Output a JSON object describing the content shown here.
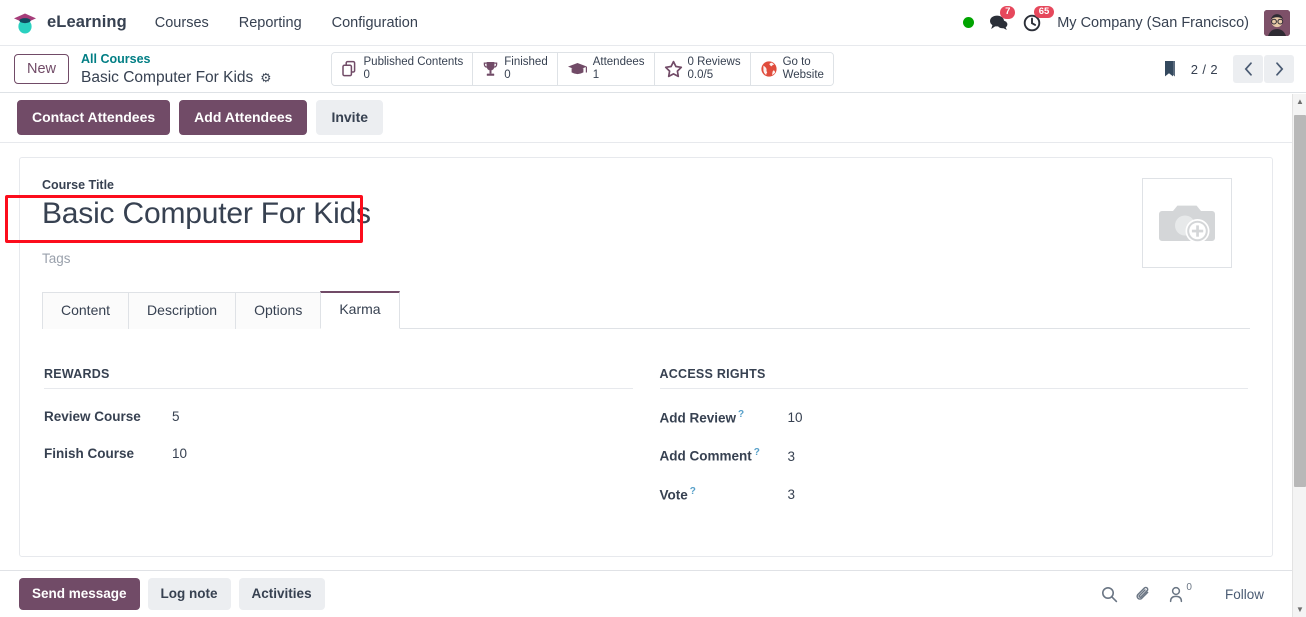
{
  "navbar": {
    "app_name": "eLearning",
    "logo_icon": "graduation-cap-icon",
    "menu": [
      {
        "label": "Courses"
      },
      {
        "label": "Reporting"
      },
      {
        "label": "Configuration"
      }
    ],
    "presence_icon": "presence-dot-online",
    "messages_icon": "messages-icon",
    "messages_count": "7",
    "activities_icon": "activities-clock-icon",
    "activities_count": "65",
    "company": "My Company (San Francisco)",
    "avatar_icon": "user-avatar"
  },
  "control_panel": {
    "new_label": "New",
    "breadcrumb_parent": "All Courses",
    "breadcrumb_current": "Basic Computer For Kids",
    "gear_icon": "gear-icon",
    "stats": [
      {
        "icon": "copy-documents-icon",
        "label": "Published Contents",
        "value": "0"
      },
      {
        "icon": "trophy-icon",
        "label": "Finished",
        "value": "0"
      },
      {
        "icon": "graduation-cap-icon",
        "label": "Attendees",
        "value": "1"
      },
      {
        "icon": "star-icon",
        "label": "0 Reviews",
        "value": "0.0/5"
      },
      {
        "icon": "globe-icon",
        "label": "Go to",
        "value": "Website"
      }
    ],
    "bookmark_icon": "bookmark-icon",
    "pager": "2 / 2",
    "prev_icon": "chevron-left-icon",
    "next_icon": "chevron-right-icon"
  },
  "action_bar": {
    "buttons": [
      {
        "label": "Contact Attendees",
        "style": "primary"
      },
      {
        "label": "Add Attendees",
        "style": "primary"
      },
      {
        "label": "Invite",
        "style": "secondary"
      }
    ],
    "highlight_color": "#fc0d1c"
  },
  "form": {
    "title_label": "Course Title",
    "title_value": "Basic Computer For Kids",
    "tags_placeholder": "Tags",
    "image_icon": "camera-add-photo-icon",
    "tabs": [
      {
        "label": "Content",
        "active": false
      },
      {
        "label": "Description",
        "active": false
      },
      {
        "label": "Options",
        "active": false
      },
      {
        "label": "Karma",
        "active": true
      }
    ],
    "groups": [
      {
        "title": "REWARDS",
        "rows": [
          {
            "label": "Review Course",
            "help": false,
            "value": "5"
          },
          {
            "label": "Finish Course",
            "help": false,
            "value": "10"
          }
        ]
      },
      {
        "title": "ACCESS RIGHTS",
        "rows": [
          {
            "label": "Add Review",
            "help": true,
            "value": "10"
          },
          {
            "label": "Add Comment",
            "help": true,
            "value": "3"
          },
          {
            "label": "Vote",
            "help": true,
            "value": "3"
          }
        ]
      }
    ]
  },
  "chatter": {
    "send_message": "Send message",
    "log_note": "Log note",
    "activities": "Activities",
    "search_icon": "search-icon",
    "attachment_icon": "paperclip-icon",
    "followers_icon": "followers-person-icon",
    "followers_count": "0",
    "follow_label": "Follow"
  },
  "colors": {
    "primary": "#714b67",
    "link": "#017e84",
    "badge": "#e6485c",
    "online": "#00a400",
    "website": "#e04c3c"
  }
}
